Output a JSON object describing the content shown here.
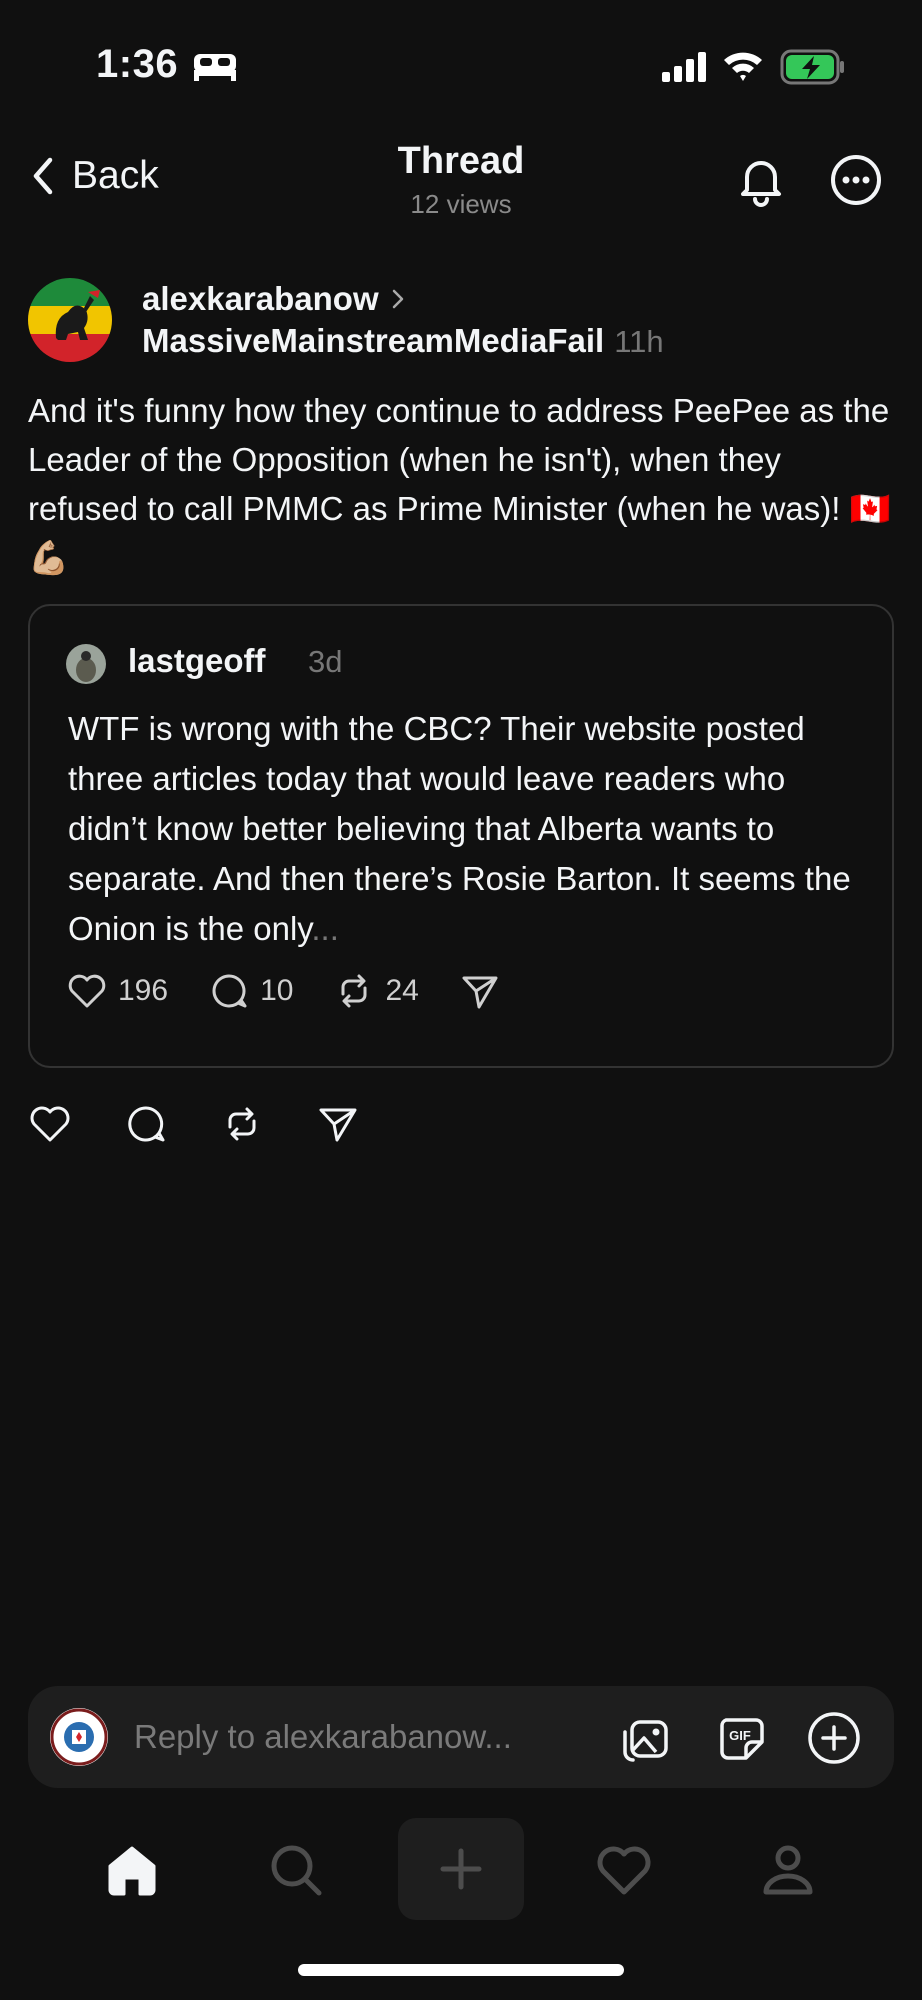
{
  "status_bar": {
    "time": "1:36",
    "sleep_icon": "bed-icon",
    "signal_icon": "cellular-signal-icon",
    "wifi_icon": "wifi-icon",
    "battery_icon": "battery-charging-icon",
    "battery_color": "#34c759"
  },
  "header": {
    "back_label": "Back",
    "title": "Thread",
    "views": "12 views"
  },
  "post": {
    "author": "alexkarabanow",
    "community": "MassiveMainstreamMediaFail",
    "time": "11h",
    "text": "And it's funny how they continue to address PeePee as the Leader of the Opposition (when he isn't), when they refused to call PMMC as Prime Minister (when he was)! 🇨🇦 💪🏼"
  },
  "quoted_post": {
    "author": "lastgeoff",
    "time": "3d",
    "text": "WTF is wrong with the CBC? Their website posted three articles today that would leave readers who didn’t know better believing that Alberta wants to separate. And then there’s Rosie Barton. It seems the Onion is the only",
    "ellipsis": "...",
    "likes": "196",
    "comments": "10",
    "reposts": "24"
  },
  "reply_bar": {
    "placeholder": "Reply to alexkarabanow..."
  },
  "colors": {
    "background": "#101010",
    "text": "#f3f5f7",
    "muted": "#777777",
    "card_border": "#333333",
    "surface": "#1e1e1e"
  }
}
